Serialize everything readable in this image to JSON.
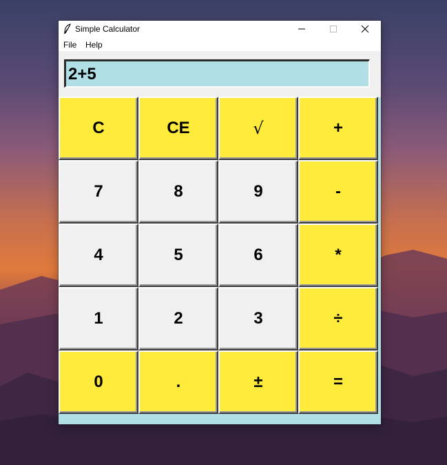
{
  "window": {
    "title": "Simple Calculator",
    "icon": "feather-icon"
  },
  "menu": {
    "file": "File",
    "help": "Help"
  },
  "display": {
    "value": "2+5"
  },
  "colors": {
    "accent_key": "#ffeb3b",
    "number_key": "#f0f0f0",
    "display_bg": "#b0e0e6"
  },
  "keys": {
    "clear": "C",
    "clear_entry": "CE",
    "sqrt": "√",
    "add": "+",
    "seven": "7",
    "eight": "8",
    "nine": "9",
    "subtract": "-",
    "four": "4",
    "five": "5",
    "six": "6",
    "multiply": "*",
    "one": "1",
    "two": "2",
    "three": "3",
    "divide": "÷",
    "zero": "0",
    "decimal": ".",
    "plus_minus": "±",
    "equals": "="
  }
}
